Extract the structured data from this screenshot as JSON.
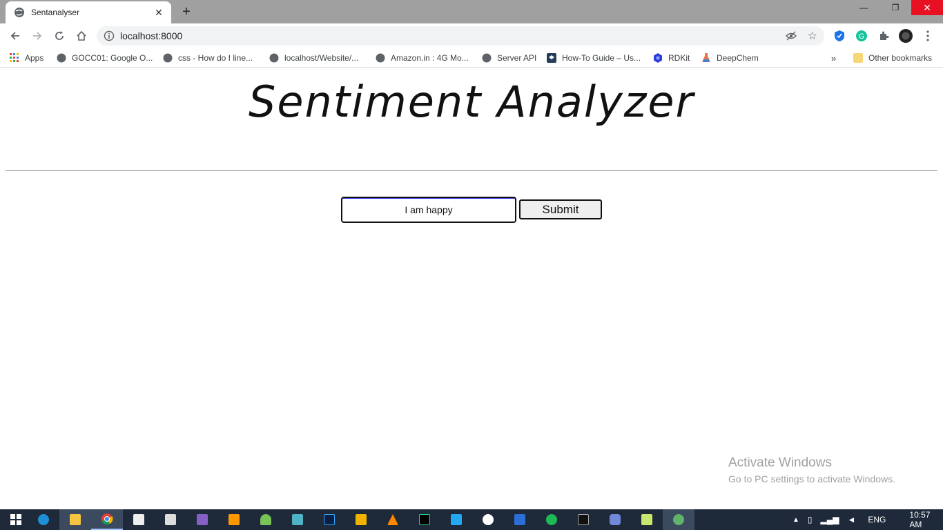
{
  "browser": {
    "tab_title": "Sentanalyser",
    "new_tab_label": "+",
    "url": "localhost:8000"
  },
  "bookmarks": [
    {
      "label": "Apps"
    },
    {
      "label": "GOCC01: Google O..."
    },
    {
      "label": "css - How do I line..."
    },
    {
      "label": "localhost/Website/..."
    },
    {
      "label": "Amazon.in : 4G Mo..."
    },
    {
      "label": "Server API"
    },
    {
      "label": "How-To Guide – Us..."
    },
    {
      "label": "RDKit"
    },
    {
      "label": "DeepChem"
    }
  ],
  "bookmarks_overflow": "»",
  "other_bookmarks": "Other bookmarks",
  "page": {
    "heading": "Sentiment Analyzer",
    "input_value": "I am happy",
    "submit_label": "Submit"
  },
  "watermark": {
    "line1": "Activate Windows",
    "line2": "Go to PC settings to activate Windows."
  },
  "taskbar": {
    "language": "ENG",
    "time": "10:57 AM"
  },
  "colors": {
    "tabstrip": "#a0a0a0",
    "close_button": "#e81123",
    "taskbar": "#1e2a3a"
  }
}
